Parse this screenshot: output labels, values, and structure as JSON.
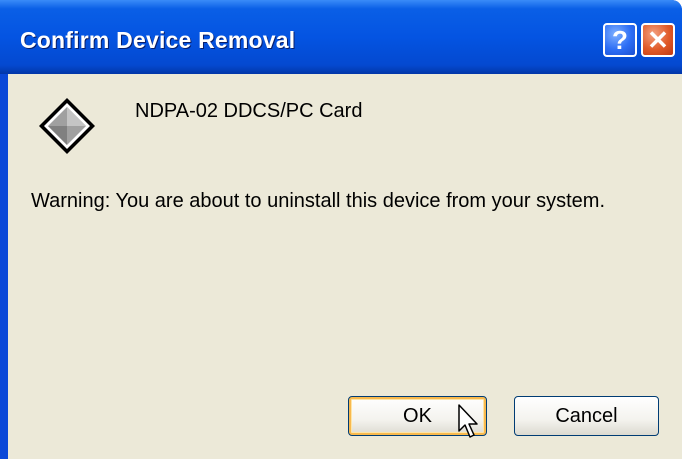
{
  "window": {
    "title": "Confirm Device Removal",
    "help_glyph": "?",
    "close_glyph": "✕"
  },
  "content": {
    "device_icon": "device-diamond-icon",
    "device_name": "NDPA-02 DDCS/PC Card",
    "warning_text": "Warning: You are about to uninstall this device from your system."
  },
  "buttons": {
    "ok_label": "OK",
    "cancel_label": "Cancel"
  },
  "colors": {
    "titlebar_blue": "#0454e2",
    "dialog_background": "#ece9d8",
    "close_red": "#e05a28",
    "focus_orange": "#f8b94e"
  }
}
